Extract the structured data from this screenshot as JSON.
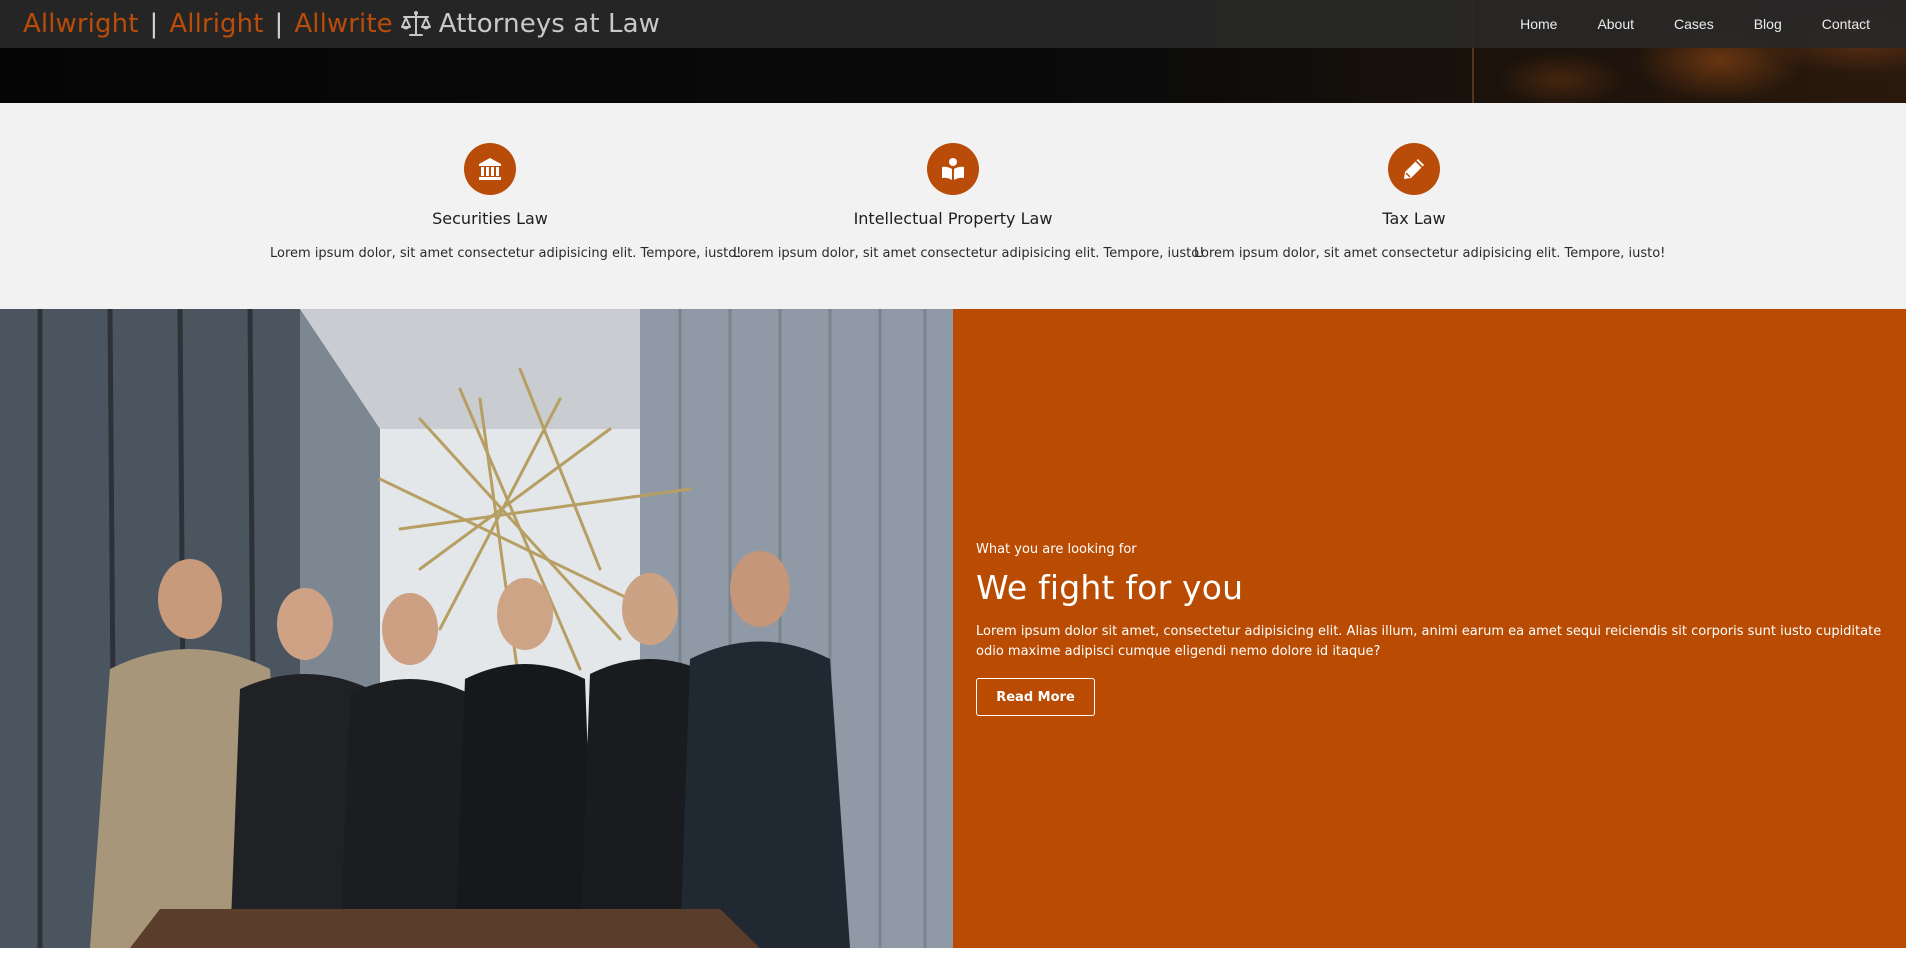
{
  "header": {
    "brand_parts": [
      "Allwright",
      "Allright",
      "Allwrite"
    ],
    "brand_separator": "|",
    "tagline": "Attorneys at Law",
    "logo_icon": "balance-scale-icon",
    "nav": [
      "Home",
      "About",
      "Cases",
      "Blog",
      "Contact"
    ]
  },
  "services": [
    {
      "icon": "bank-icon",
      "title": "Securities Law",
      "desc": "Lorem ipsum dolor, sit amet consectetur adipisicing elit. Tempore, iusto!"
    },
    {
      "icon": "book-reader-icon",
      "title": "Intellectual Property Law",
      "desc": "Lorem ipsum dolor, sit amet consectetur adipisicing elit. Tempore, iusto!"
    },
    {
      "icon": "pencil-icon",
      "title": "Tax Law",
      "desc": "Lorem ipsum dolor, sit amet consectetur adipisicing elit. Tempore, iusto!"
    }
  ],
  "promo": {
    "eyebrow": "What you are looking for",
    "headline": "We fight for you",
    "body": "Lorem ipsum dolor sit amet, consectetur adipisicing elit. Alias illum, animi earum ea amet sequi reiciendis sit corporis sunt iusto cupiditate odio maxime adipisci cumque eligendi nemo dolore id itaque?",
    "button": "Read More"
  },
  "colors": {
    "accent": "#b94c09",
    "navbar_bg": "#282828",
    "services_bg": "#f2f2f2",
    "promo_bg": "#b94c02"
  }
}
